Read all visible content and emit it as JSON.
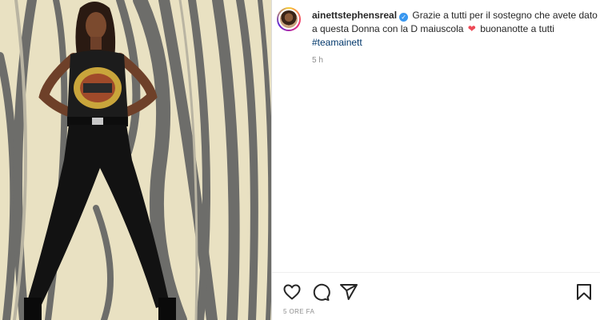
{
  "post": {
    "username": "ainettstephensreal",
    "verified_mark": "✓",
    "caption_part1": "Grazie a tutti per il sostegno che avete dato a questa Donna con la D maiuscola",
    "heart_emoji": "❤",
    "caption_part2": "buonanotte a tutti",
    "hashtag": "#teamainett",
    "time_relative": "5 h",
    "time_footer": "5 ORE FA"
  },
  "icons": {
    "like": "heart-icon",
    "comment": "comment-icon",
    "share": "send-icon",
    "save": "bookmark-icon"
  },
  "colors": {
    "verified": "#3897f0",
    "heart": "#ed4956",
    "hashtag": "#00376b",
    "muted": "#8e8e8e"
  }
}
